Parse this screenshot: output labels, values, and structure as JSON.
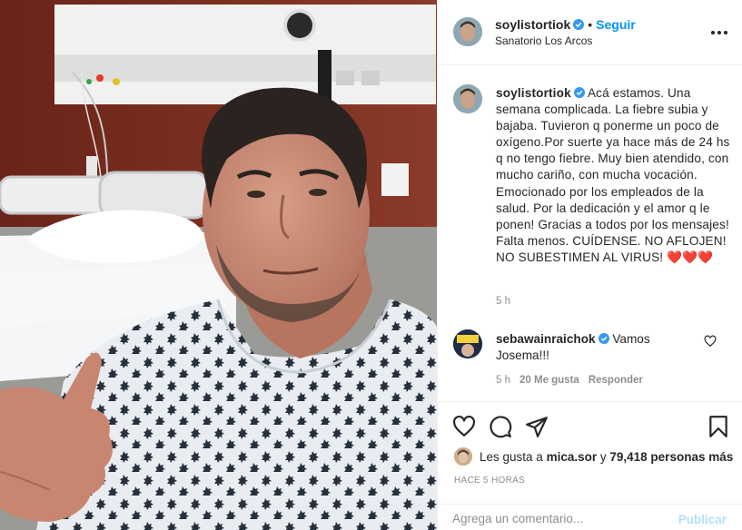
{
  "post": {
    "username": "soylistortiok",
    "follow_label": "Seguir",
    "separator": "•",
    "location": "Sanatorio Los Arcos"
  },
  "caption": {
    "username": "soylistortiok",
    "text": "Acá estamos. Una semana complicada. La fiebre subia y bajaba. Tuvieron q ponerme un poco de oxígeno.Por suerte ya hace más de 24 hs q no tengo fiebre. Muy bien atendido, con mucho cariño, con mucha vocación. Emocionado por los empleados de la salud. Por la dedicación y el amor q le ponen! Gracias a todos por los mensajes! Falta menos. CUÍDENSE. NO AFLOJEN! NO SUBESTIMEN AL VIRUS!",
    "emoji": "❤️❤️❤️",
    "time": "5 h"
  },
  "comment": {
    "username": "sebawainraichok",
    "text": "Vamos Josema!!!",
    "time": "5 h",
    "likes": "20 Me gusta",
    "reply_label": "Responder"
  },
  "likes": {
    "prefix": "Les gusta a",
    "user": "mica.sor",
    "joiner": "y",
    "count_text": "79,418 personas más"
  },
  "post_age": "HACE 5 HORAS",
  "add_comment": {
    "placeholder": "Agrega un comentario...",
    "post_label": "Publicar"
  },
  "colors": {
    "accent": "#0095f6",
    "verified": "#3897f0",
    "heart": "#ed4956",
    "muted": "#8e8e8e",
    "post_disabled": "#b2dffc"
  },
  "icons": {
    "more": "ellipsis-icon",
    "like": "heart-outline-icon",
    "comment": "speech-bubble-icon",
    "share": "paper-plane-icon",
    "save": "bookmark-icon",
    "verified": "verified-badge-icon"
  }
}
